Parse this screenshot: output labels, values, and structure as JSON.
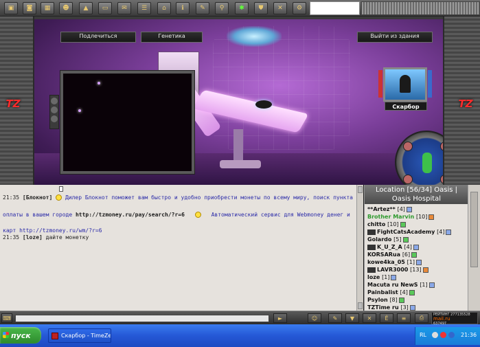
{
  "scene": {
    "labels": [
      "Подлечиться",
      "Генетика",
      "Выйти из здания"
    ],
    "avatar_name": "Скарбор"
  },
  "chat": {
    "lines": [
      {
        "time": "21:35",
        "nick": "[Блокнот]",
        "text": "Дилер Блокнот поможет вам быстро и удобно приобрести монеты по всему миру, поиск пункта"
      },
      {
        "text_a": "оплаты в вашем городе ",
        "url": "http://tzmoney.ru/pay/search/?r=6",
        "text_b": "Автоматический сервис для Webmoney денег и"
      },
      {
        "text_a": "карт ",
        "url2": "http://tzmoney.ru/wm/?r=6"
      },
      {
        "time": "21:35",
        "nick": "[loze]",
        "text": "дайте монетку"
      }
    ]
  },
  "location": {
    "title_line1": "Location [56/34] Oasis |",
    "title_line2": "Oasis Hospital",
    "players": [
      {
        "name": "**Artez**",
        "level": "[4]",
        "badge": "blue"
      },
      {
        "name": "Brother Marvin",
        "level": "[10]",
        "badge": "orange",
        "green": true
      },
      {
        "name": "chitto",
        "level": "[10]",
        "badge": "green"
      },
      {
        "name": "FightCatsAcademy",
        "level": "[4]",
        "badge": "blue",
        "prefix": true
      },
      {
        "name": "Golardo",
        "level": "[5]",
        "badge": "green"
      },
      {
        "name": "K_U_Z_A",
        "level": "[4]",
        "badge": "blue",
        "prefix": true
      },
      {
        "name": "KORSARua",
        "level": "[6]",
        "badge": "green"
      },
      {
        "name": "kowe4ka_05",
        "level": "[1]",
        "badge": "blue"
      },
      {
        "name": "LAVR3000",
        "level": "[13]",
        "badge": "orange",
        "prefix": true
      },
      {
        "name": "loze",
        "level": "[1]",
        "badge": "blue"
      },
      {
        "name": "Macuta ru NewS",
        "level": "[1]",
        "badge": "blue"
      },
      {
        "name": "Painbalist",
        "level": "[4]",
        "badge": "green"
      },
      {
        "name": "Psylon",
        "level": "[8]",
        "badge": "green"
      },
      {
        "name": "TZTime ru",
        "level": "[3]",
        "badge": "blue"
      }
    ]
  },
  "gamebar": {
    "rating_line1": "РЕЙТИНГ 277135528",
    "rating_line2": "mail.ru",
    "rating_line3": "637497",
    "rating_line4": "28539"
  },
  "taskbar": {
    "start_label": "пуск",
    "task_label": "Скарбор - TimeZer...",
    "lang": "RL",
    "clock": "21:36"
  },
  "colors": {
    "accent": "#2558d6",
    "scene_purple": "#7a3e99",
    "chat_blue": "#2a2aa8"
  }
}
